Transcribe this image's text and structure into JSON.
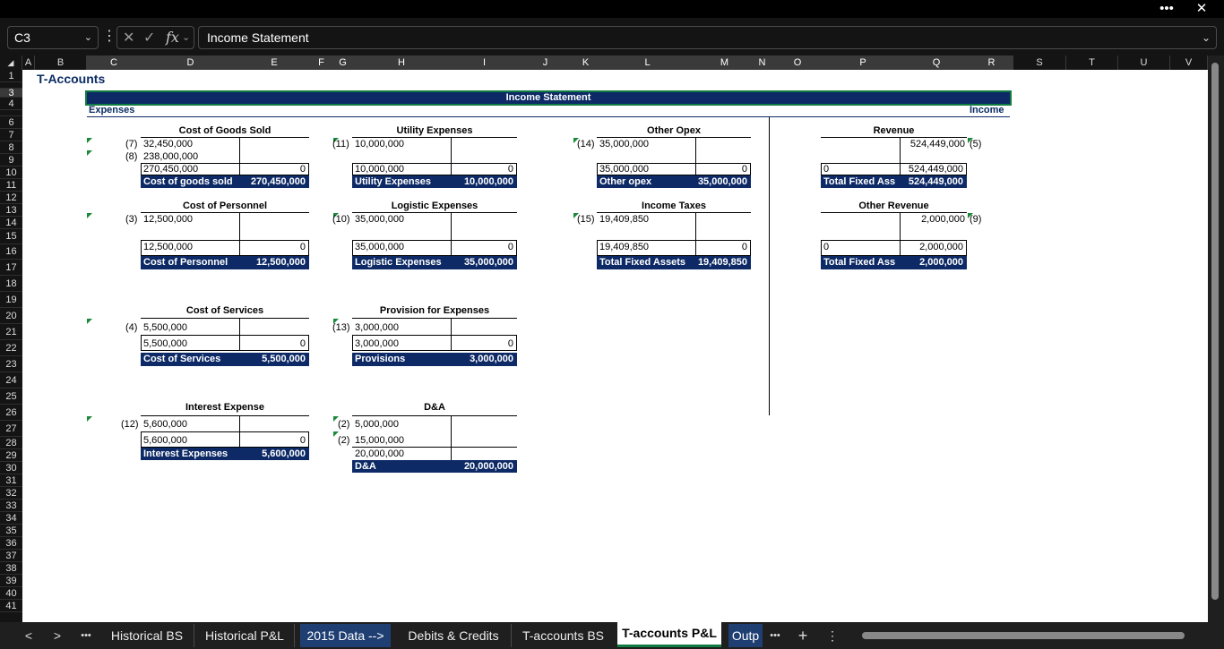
{
  "window": {
    "more_label": "•••",
    "close_label": "✕"
  },
  "formula_bar": {
    "name_box": "C3",
    "formula": "Income Statement",
    "fx_label": "fx",
    "cancel_glyph": "✕",
    "enter_glyph": "✓"
  },
  "columns": [
    "A",
    "B",
    "C",
    "D",
    "E",
    "F",
    "G",
    "H",
    "I",
    "J",
    "K",
    "L",
    "M",
    "N",
    "O",
    "P",
    "Q",
    "R",
    "S",
    "T",
    "U",
    "V"
  ],
  "rows": [
    "1",
    "2",
    "3",
    "4",
    "5",
    "6",
    "7",
    "8",
    "9",
    "10",
    "11",
    "12",
    "13",
    "14",
    "15",
    "16",
    "17",
    "18",
    "19",
    "20",
    "21",
    "22",
    "23",
    "24",
    "25",
    "26",
    "27",
    "28",
    "29",
    "30",
    "31",
    "32",
    "33",
    "34",
    "35",
    "36",
    "37",
    "38",
    "39",
    "40",
    "41"
  ],
  "sheet": {
    "title": "T-Accounts",
    "header": "Income Statement",
    "expenses_label": "Expenses",
    "income_label": "Income",
    "accounts": {
      "cogs": {
        "title": "Cost of Goods Sold",
        "ref1": "(7)",
        "entry1": "32,450,000",
        "ref2": "(8)",
        "entry2": "238,000,000",
        "debit_total": "270,450,000",
        "credit_total": "0",
        "label": "Cost of goods sold",
        "amount": "270,450,000"
      },
      "utility": {
        "title": "Utility Expenses",
        "ref1": "(11)",
        "entry1": "10,000,000",
        "debit_total": "10,000,000",
        "credit_total": "0",
        "label": "Utility Expenses",
        "amount": "10,000,000"
      },
      "other_opex": {
        "title": "Other Opex",
        "ref1": "(14)",
        "entry1": "35,000,000",
        "debit_total": "35,000,000",
        "credit_total": "0",
        "label": "Other opex",
        "amount": "35,000,000"
      },
      "revenue": {
        "title": "Revenue",
        "entry1": "524,449,000",
        "ref1": "(5)",
        "debit_total": "0",
        "credit_total": "524,449,000",
        "label": "Total Fixed Ass",
        "amount": "524,449,000"
      },
      "personnel": {
        "title": "Cost of Personnel",
        "ref1": "(3)",
        "entry1": "12,500,000",
        "debit_total": "12,500,000",
        "credit_total": "0",
        "label": "Cost of Personnel",
        "amount": "12,500,000"
      },
      "logistic": {
        "title": "Logistic Expenses",
        "ref1": "(10)",
        "entry1": "35,000,000",
        "debit_total": "35,000,000",
        "credit_total": "0",
        "label": "Logistic Expenses",
        "amount": "35,000,000"
      },
      "taxes": {
        "title": "Income Taxes",
        "ref1": "(15)",
        "entry1": "19,409,850",
        "debit_total": "19,409,850",
        "credit_total": "0",
        "label": "Total Fixed Assets",
        "amount": "19,409,850"
      },
      "other_revenue": {
        "title": "Other Revenue",
        "entry1": "2,000,000",
        "ref1": "(9)",
        "debit_total": "0",
        "credit_total": "2,000,000",
        "label": "Total Fixed Ass",
        "amount": "2,000,000"
      },
      "services": {
        "title": "Cost of Services",
        "ref1": "(4)",
        "entry1": "5,500,000",
        "debit_total": "5,500,000",
        "credit_total": "0",
        "label": "Cost of Services",
        "amount": "5,500,000"
      },
      "provision": {
        "title": "Provision for Expenses",
        "ref1": "(13)",
        "entry1": "3,000,000",
        "debit_total": "3,000,000",
        "credit_total": "0",
        "label": "Provisions",
        "amount": "3,000,000"
      },
      "interest": {
        "title": "Interest Expense",
        "ref1": "(12)",
        "entry1": "5,600,000",
        "debit_total": "5,600,000",
        "credit_total": "0",
        "label": "Interest Expenses",
        "amount": "5,600,000"
      },
      "dna": {
        "title": "D&A",
        "ref1": "(2)",
        "entry1": "5,000,000",
        "ref2": "(2)",
        "entry2": "15,000,000",
        "debit_total": "20,000,000",
        "label": "D&A",
        "amount": "20,000,000"
      }
    }
  },
  "tabs": {
    "prev": "<",
    "next": ">",
    "more_left": "•••",
    "items": [
      "Historical BS",
      "Historical P&L",
      "2015 Data -->",
      "Debits & Credits",
      "T-accounts BS",
      "T-accounts P&L",
      "Outp"
    ],
    "more_right": "•••",
    "add": "+",
    "options": "⋮"
  },
  "colors": {
    "header_navy": "#0d2a66",
    "active_tab_underline": "#107c41",
    "note_marker": "#1a8a3a"
  }
}
